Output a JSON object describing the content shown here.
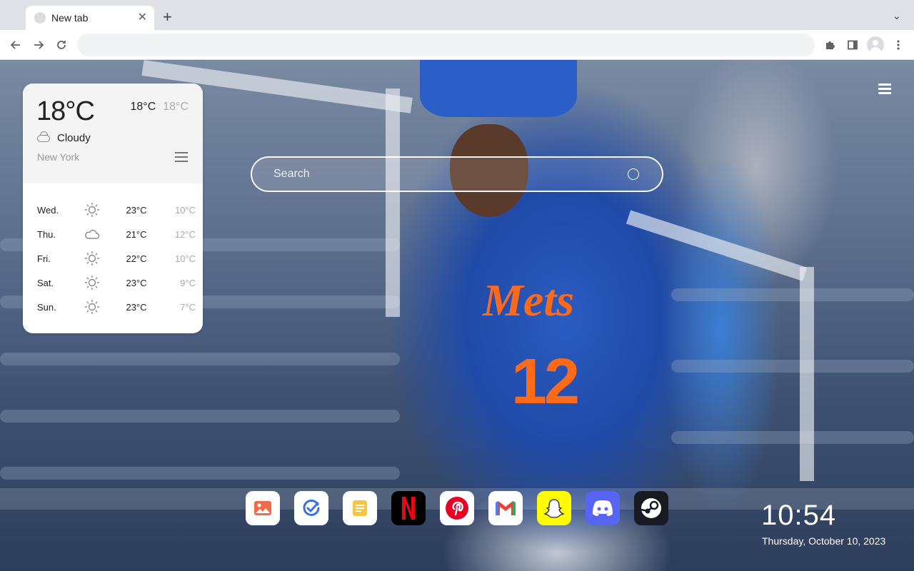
{
  "browser": {
    "tab_title": "New tab",
    "new_tab_symbol": "+",
    "omnibox_value": ""
  },
  "weather": {
    "current_temp": "18°C",
    "high": "18°C",
    "low": "18°C",
    "condition": "Cloudy",
    "city": "New York",
    "forecast": [
      {
        "day": "Wed.",
        "icon": "sun-icon",
        "high": "23°C",
        "low": "10°C"
      },
      {
        "day": "Thu.",
        "icon": "cloud-icon",
        "high": "21°C",
        "low": "12°C"
      },
      {
        "day": "Fri.",
        "icon": "sun-icon",
        "high": "22°C",
        "low": "10°C"
      },
      {
        "day": "Sat.",
        "icon": "sun-icon",
        "high": "23°C",
        "low": "9°C"
      },
      {
        "day": "Sun.",
        "icon": "sun-icon",
        "high": "23°C",
        "low": "7°C"
      }
    ]
  },
  "search": {
    "placeholder": "Search"
  },
  "dock": [
    {
      "name": "photos-app",
      "icon": "image-icon",
      "bg": "#ffffff"
    },
    {
      "name": "tasks-app",
      "icon": "check-circle-icon",
      "bg": "#ffffff"
    },
    {
      "name": "notes-app",
      "icon": "note-icon",
      "bg": "#ffffff"
    },
    {
      "name": "netflix-app",
      "icon": "netflix-icon",
      "bg": "#000000"
    },
    {
      "name": "pinterest-app",
      "icon": "pinterest-icon",
      "bg": "#ffffff"
    },
    {
      "name": "gmail-app",
      "icon": "gmail-icon",
      "bg": "#ffffff"
    },
    {
      "name": "snapchat-app",
      "icon": "snapchat-icon",
      "bg": "#fffc00"
    },
    {
      "name": "discord-app",
      "icon": "discord-icon",
      "bg": "#5865f2"
    },
    {
      "name": "steam-app",
      "icon": "steam-icon",
      "bg": "#171a21"
    }
  ],
  "clock": {
    "time": "10:54",
    "date": "Thursday, October 10, 2023"
  },
  "background": {
    "jersey_number": "12",
    "jersey_text": "Mets"
  }
}
